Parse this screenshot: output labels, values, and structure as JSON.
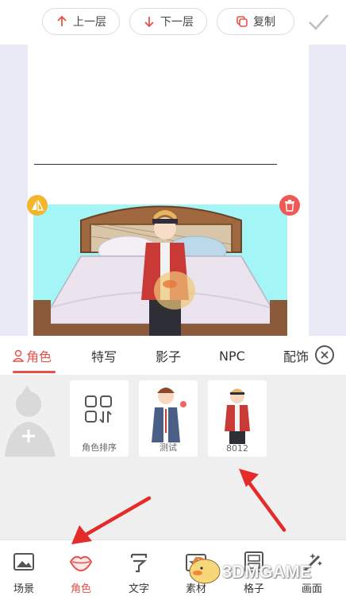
{
  "toolbar": {
    "up_label": "上一层",
    "down_label": "下一层",
    "copy_label": "复制"
  },
  "tabs": [
    {
      "label": "角色",
      "active": true
    },
    {
      "label": "特写"
    },
    {
      "label": "影子"
    },
    {
      "label": "NPC"
    },
    {
      "label": "配饰"
    }
  ],
  "assets": [
    {
      "label": ""
    },
    {
      "label": "角色排序"
    },
    {
      "label": "测试"
    },
    {
      "label": "8012"
    }
  ],
  "bottom_nav": [
    {
      "label": "场景",
      "icon": "image-icon"
    },
    {
      "label": "角色",
      "icon": "lips-icon",
      "active": true
    },
    {
      "label": "文字",
      "icon": "text-icon"
    },
    {
      "label": "素材",
      "icon": "sticker-icon"
    },
    {
      "label": "格子",
      "icon": "panel-icon"
    },
    {
      "label": "画面",
      "icon": "magic-wand-icon"
    }
  ],
  "watermark": {
    "text": "3DMGAME"
  },
  "colors": {
    "accent": "#e8504c",
    "canvas_bg": "#e9eaf6",
    "scene_bg": "#a4f5f5",
    "flip_handle": "#f3b52a",
    "delete_handle": "#f05a55",
    "annotation_arrow": "#e52a2a"
  }
}
